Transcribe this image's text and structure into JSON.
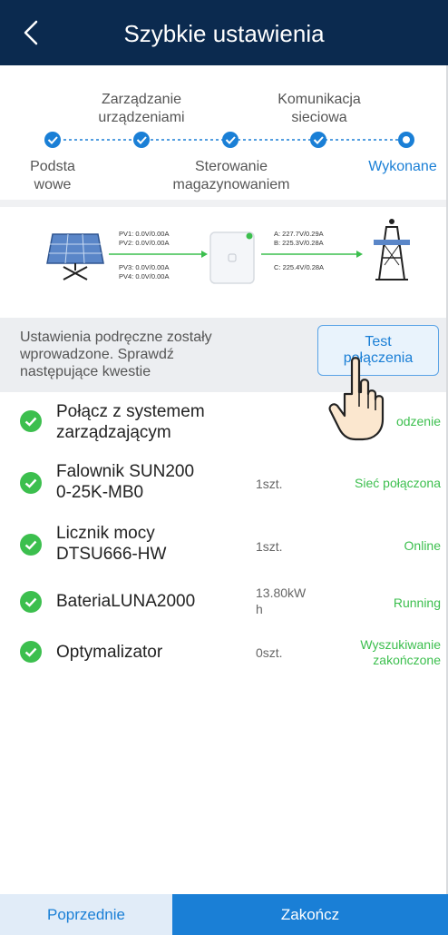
{
  "header": {
    "title": "Szybkie ustawienia",
    "back_icon": "chevron-left-icon"
  },
  "steps": [
    {
      "label_lines": [
        "Podsta",
        "wowe"
      ],
      "state": "done"
    },
    {
      "label_lines": [
        "Zarządzanie",
        "urządzeniami"
      ],
      "state": "done"
    },
    {
      "label_lines": [
        "Sterowanie",
        "magazynowaniem"
      ],
      "state": "done"
    },
    {
      "label_lines": [
        "Komunikacja",
        "sieciowa"
      ],
      "state": "done"
    },
    {
      "label_lines": [
        "Wykonane"
      ],
      "state": "current"
    }
  ],
  "diagram": {
    "pv_lines": [
      "PV1: 0.0V/0.00A",
      "PV2: 0.0V/0.00A",
      "PV3: 0.0V/0.00A",
      "PV4: 0.0V/0.00A"
    ],
    "grid_lines": [
      "A: 227.7V/0.29A",
      "B: 225.3V/0.28A",
      "C: 225.4V/0.28A"
    ]
  },
  "notice": {
    "text_lines": [
      "Ustawienia podręczne zostały",
      "wprowadzone. Sprawdź",
      "następujące kwestie"
    ]
  },
  "test_button": {
    "label_lines": [
      "Test",
      "połączenia"
    ]
  },
  "items": [
    {
      "name_lines": [
        "Połącz z systemem",
        "zarządzającym"
      ],
      "qty": "",
      "status_lines": [
        "odzenie"
      ]
    },
    {
      "name_lines": [
        "Falownik SUN200",
        "0-25K-MB0"
      ],
      "qty": "1szt.",
      "status_lines": [
        "Sieć połączona"
      ]
    },
    {
      "name_lines": [
        "Licznik mocy",
        "DTSU666-HW"
      ],
      "qty": "1szt.",
      "status_lines": [
        "Online"
      ]
    },
    {
      "name_lines": [
        "BateriaLUNA2000"
      ],
      "qty_lines": [
        "13.80kW",
        "h"
      ],
      "qty": "",
      "status_lines": [
        "Running"
      ]
    },
    {
      "name_lines": [
        "Optymalizator"
      ],
      "qty": "0szt.",
      "status_lines": [
        "Wyszukiwanie",
        "zakończone"
      ]
    }
  ],
  "footer": {
    "prev_label": "Poprzednie",
    "finish_label": "Zakończ"
  },
  "colors": {
    "header_bg": "#0b2a4f",
    "accent": "#1a7fd6",
    "success": "#3cbf4e"
  }
}
